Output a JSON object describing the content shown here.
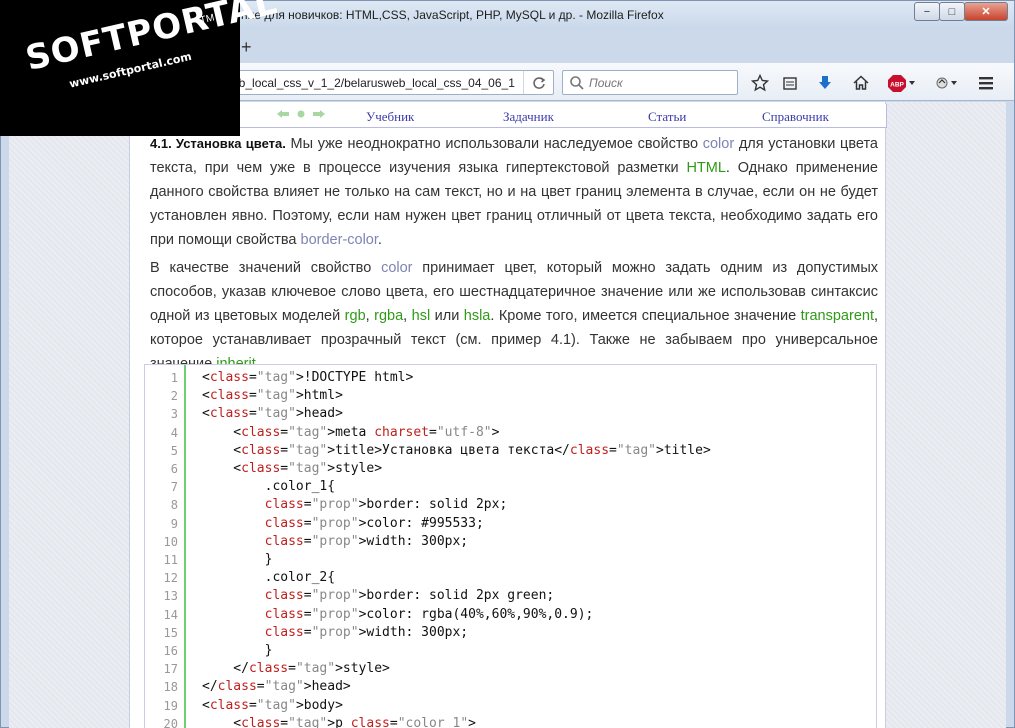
{
  "window": {
    "title": "ние для новичков: HTML,CSS, JavaScript, PHP, MySQL и др. - Mozilla Firefox",
    "controls": {
      "minimize": "−",
      "maximize": "□",
      "close": "✕"
    }
  },
  "tabstrip": {
    "new_tab": "+"
  },
  "navbar": {
    "url": "eb_local_css_v_1_2/belarusweb_local_css_04_06_1",
    "search_placeholder": "Поиск",
    "abp_label": "ABP"
  },
  "watermark": {
    "brand": "SOFTPORTAL",
    "tm": "TM",
    "url": "www.softportal.com"
  },
  "topmenu": {
    "items": [
      "Учебник",
      "Задачник",
      "Статьи",
      "Справочник"
    ]
  },
  "content": {
    "p1": {
      "heading": "4.1. Установка цвета.",
      "t1": " Мы уже неоднократно использовали наследуемое свойство ",
      "kw1": "color",
      "t2": " для установки цвета текста, при чем уже в процессе изучения языка гипертекстовой разметки ",
      "kw2": "HTML",
      "t3": ". Однако применение данного свойства влияет не только на сам текст, но и на цвет границ элемента в случае, если он не будет установлен явно. Поэтому, если нам нужен цвет границ отличный от цвета текста, необходимо задать его при помощи свойства ",
      "kw3": "border-color",
      "t4": "."
    },
    "p2": {
      "t1": "В качестве значений свойство ",
      "kw1": "color",
      "t2": " принимает цвет, который можно задать одним из допустимых способов, указав ключевое слово цвета, его шестнадцатеричное значение или же использовав синтаксис одной из цветовых моделей ",
      "kw2": "rgb",
      "t3": ", ",
      "kw3": "rgba",
      "t4": ", ",
      "kw4": "hsl",
      "t5": " или ",
      "kw5": "hsla",
      "t6": ". Кроме того, имеется специальное значение ",
      "kw6": "transparent",
      "t7": ", которое устанавливает прозрачный текст (см. пример 4.1). Также не забываем про универсальное значение ",
      "kw7": "inherit",
      "t8": "."
    }
  },
  "code": {
    "line_numbers": [
      "1",
      "2",
      "3",
      "4",
      "5",
      "6",
      "7",
      "8",
      "9",
      "10",
      "11",
      "12",
      "13",
      "14",
      "15",
      "16",
      "17",
      "18",
      "19",
      "20"
    ],
    "lines": [
      "<!DOCTYPE html>",
      "<html>",
      "<head>",
      "    <meta charset=\"utf-8\">",
      "    <title>Установка цвета текста</title>",
      "    <style>",
      "        .color_1{",
      "        border: solid 2px;",
      "        color: #995533;",
      "        width: 300px;",
      "        }",
      "        .color_2{",
      "        border: solid 2px green;",
      "        color: rgba(40%,60%,90%,0.9);",
      "        width: 300px;",
      "        }",
      "    </style>",
      "</head>",
      "<body>",
      "    <p class=\"color_1\">"
    ]
  },
  "colors": {
    "link": "#3b3ba8",
    "keyword_gray": "#7e84b5",
    "keyword_green": "#2f9a18",
    "gutter": "#6ecf6e"
  }
}
